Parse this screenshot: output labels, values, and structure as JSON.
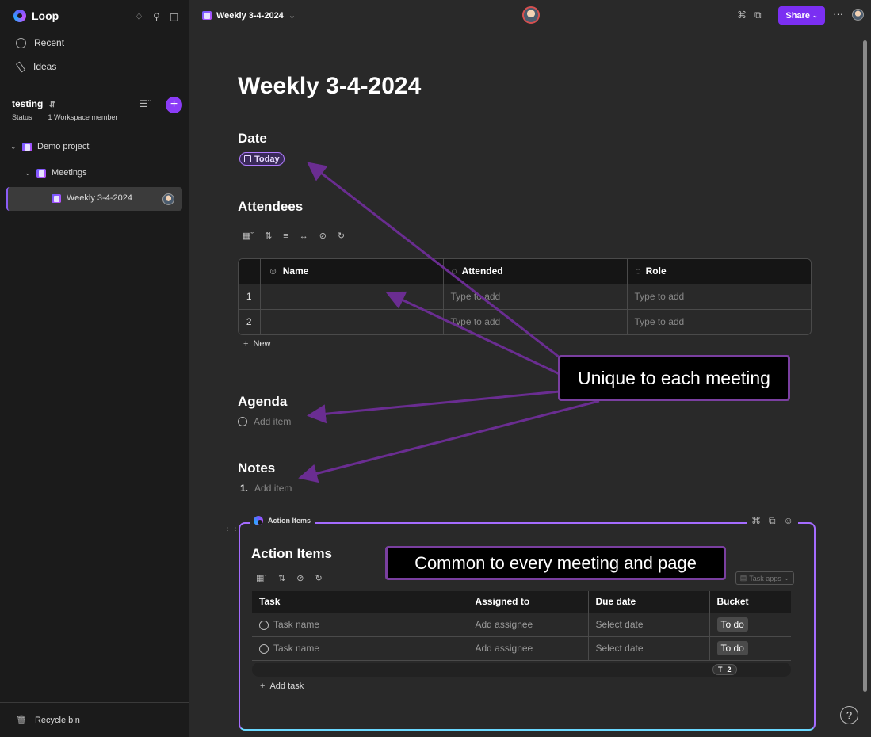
{
  "app": {
    "name": "Loop"
  },
  "sidebar": {
    "nav": [
      {
        "label": "Recent",
        "icon": "clock-icon"
      },
      {
        "label": "Ideas",
        "icon": "pen-icon"
      }
    ],
    "workspace": {
      "name": "testing",
      "status": "Status",
      "members": "1 Workspace member"
    },
    "tree": [
      {
        "label": "Demo project"
      },
      {
        "label": "Meetings"
      },
      {
        "label": "Weekly 3-4-2024"
      }
    ],
    "recycle": "Recycle bin"
  },
  "topbar": {
    "breadcrumb": "Weekly 3-4-2024",
    "share": "Share"
  },
  "page": {
    "title": "Weekly 3-4-2024",
    "date": {
      "heading": "Date",
      "pill": "Today"
    },
    "attendees": {
      "heading": "Attendees",
      "columns": [
        "Name",
        "Attended",
        "Role"
      ],
      "rows": [
        {
          "num": "1",
          "attended": "Type to add",
          "role": "Type to add"
        },
        {
          "num": "2",
          "attended": "Type to add",
          "role": "Type to add"
        }
      ],
      "new_label": "New"
    },
    "agenda": {
      "heading": "Agenda",
      "placeholder": "Add item"
    },
    "notes": {
      "heading": "Notes",
      "number": "1.",
      "placeholder": "Add item"
    }
  },
  "loop_component": {
    "label": "Action Items",
    "title": "Action Items",
    "task_apps": "Task apps",
    "columns": [
      "Task",
      "Assigned to",
      "Due date",
      "Bucket"
    ],
    "rows": [
      {
        "task": "Task name",
        "assignee": "Add assignee",
        "due": "Select date",
        "bucket": "To do"
      },
      {
        "task": "Task name",
        "assignee": "Add assignee",
        "due": "Select date",
        "bucket": "To do"
      }
    ],
    "summary": {
      "letter": "T",
      "count": "2"
    },
    "add_task": "Add task"
  },
  "callouts": {
    "unique": "Unique to each meeting",
    "common": "Common to every meeting and page"
  },
  "colors": {
    "accent": "#8b3cf7",
    "callout_border": "#7a3fa0",
    "background": "#292929"
  }
}
